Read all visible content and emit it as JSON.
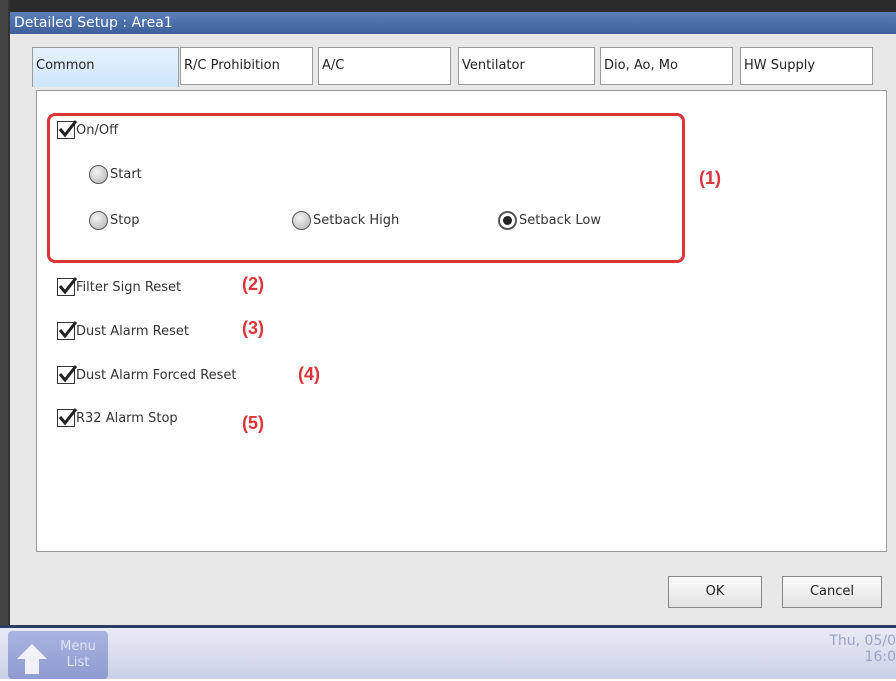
{
  "window": {
    "title": "Detailed Setup : Area1"
  },
  "tabs": [
    {
      "label": "Common",
      "active": true
    },
    {
      "label": "R/C Prohibition",
      "active": false
    },
    {
      "label": "A/C",
      "active": false
    },
    {
      "label": "Ventilator",
      "active": false
    },
    {
      "label": "Dio, Ao, Mo",
      "active": false
    },
    {
      "label": "HW Supply",
      "active": false
    }
  ],
  "common": {
    "onoff": {
      "label": "On/Off",
      "checked": true
    },
    "radios": {
      "start": {
        "label": "Start",
        "selected": false
      },
      "stop": {
        "label": "Stop",
        "selected": false
      },
      "setback_high": {
        "label": "Setback High",
        "selected": false
      },
      "setback_low": {
        "label": "Setback Low",
        "selected": true
      }
    },
    "filter_sign_reset": {
      "label": "Filter Sign Reset",
      "checked": true
    },
    "dust_alarm_reset": {
      "label": "Dust Alarm Reset",
      "checked": true
    },
    "dust_alarm_forced_reset": {
      "label": "Dust Alarm Forced Reset",
      "checked": true
    },
    "r32_alarm_stop": {
      "label": "R32 Alarm Stop",
      "checked": true
    }
  },
  "annotations": {
    "a1": "(1)",
    "a2": "(2)",
    "a3": "(3)",
    "a4": "(4)",
    "a5": "(5)",
    "color": "#d9353a"
  },
  "buttons": {
    "ok": "OK",
    "cancel": "Cancel"
  },
  "taskbar": {
    "menu_line1": "Menu",
    "menu_line2": "List",
    "date": "Thu, 05/0",
    "time": "16:0"
  }
}
